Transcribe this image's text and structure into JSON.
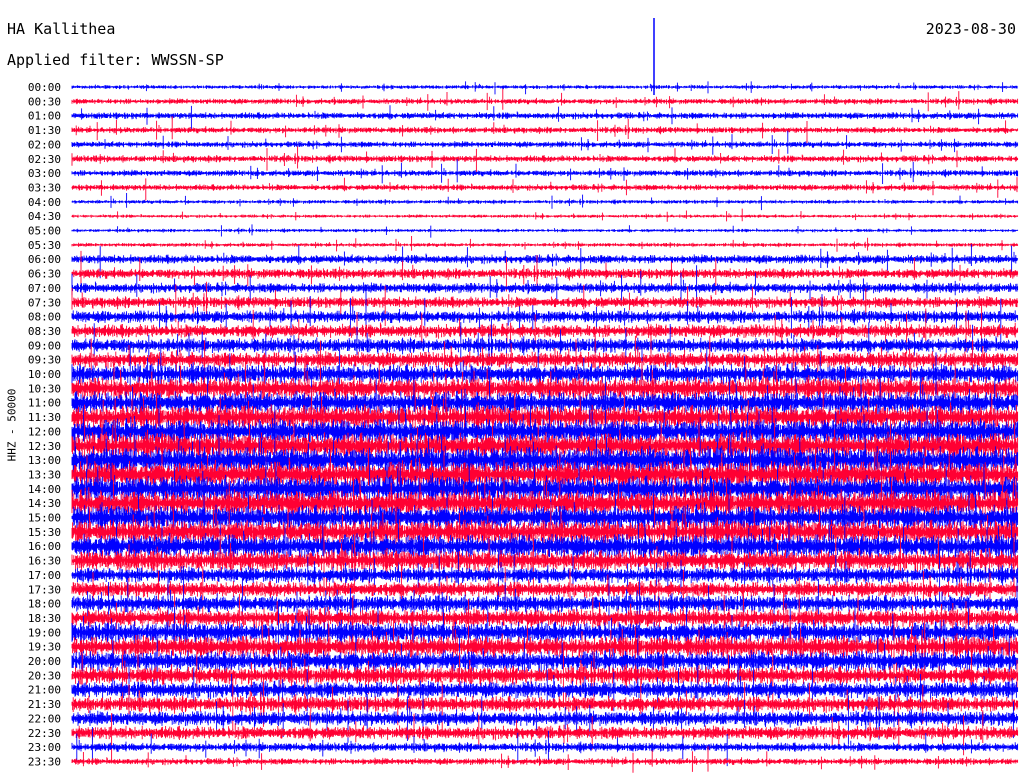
{
  "chart_data": {
    "type": "line",
    "title": "HA Kallithea",
    "date": "2023-08-30",
    "filter_label": "Applied filter: WWSSN-SP",
    "ylabel": "HHZ - 50000",
    "xlabel": "",
    "row_labels": [
      "00:00",
      "00:30",
      "01:00",
      "01:30",
      "02:00",
      "02:30",
      "03:00",
      "03:30",
      "04:00",
      "04:30",
      "05:00",
      "05:30",
      "06:00",
      "06:30",
      "07:00",
      "07:30",
      "08:00",
      "08:30",
      "09:00",
      "09:30",
      "10:00",
      "10:30",
      "11:00",
      "11:30",
      "12:00",
      "12:30",
      "13:00",
      "13:30",
      "14:00",
      "14:30",
      "15:00",
      "15:30",
      "16:00",
      "16:30",
      "17:00",
      "17:30",
      "18:00",
      "18:30",
      "19:00",
      "19:30",
      "20:00",
      "20:30",
      "21:00",
      "21:30",
      "22:00",
      "22:30",
      "23:00",
      "23:30"
    ],
    "row_colors": [
      "#0000ff",
      "#ff0033"
    ],
    "relative_amplitude": [
      0.35,
      0.5,
      0.6,
      0.55,
      0.55,
      0.6,
      0.55,
      0.55,
      0.35,
      0.3,
      0.3,
      0.35,
      0.8,
      0.9,
      0.9,
      1.0,
      1.1,
      1.2,
      1.3,
      1.4,
      1.7,
      1.9,
      2.0,
      2.1,
      2.2,
      2.3,
      2.4,
      2.4,
      2.3,
      2.3,
      2.2,
      2.1,
      2.2,
      1.8,
      1.4,
      1.4,
      1.5,
      1.6,
      1.8,
      1.9,
      1.8,
      1.6,
      1.5,
      1.4,
      1.3,
      1.2,
      0.8,
      0.6
    ],
    "grid": false
  }
}
